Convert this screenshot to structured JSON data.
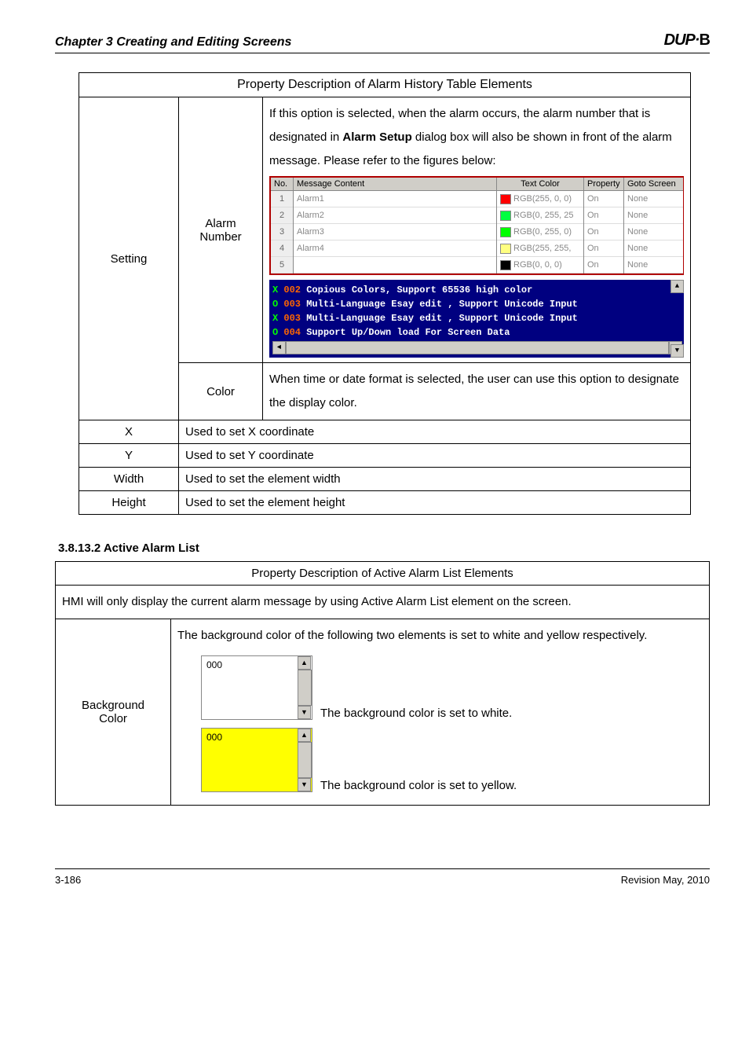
{
  "header": {
    "chapter": "Chapter 3 Creating and Editing Screens",
    "logo_prefix": "DUP",
    "logo_dot": "·",
    "logo_b": "B"
  },
  "table1": {
    "title": "Property Description of Alarm History Table Elements",
    "setting_label": "Setting",
    "alarm_number_label_l1": "Alarm",
    "alarm_number_label_l2": "Number",
    "alarm_desc": "If this option is selected, when the alarm occurs, the alarm number that is designated in <b>Alarm Setup</b> dialog box will also be shown in front of the alarm message. Please refer to the figures below:",
    "grid": {
      "headers": {
        "no": "No.",
        "msg": "Message Content",
        "tc": "Text Color",
        "prop": "Property",
        "goto": "Goto Screen"
      },
      "rows": [
        {
          "no": "1",
          "msg": "Alarm1",
          "tc": "RGB(255, 0, 0)",
          "sw": "#ff0000",
          "prop": "On",
          "goto": "None"
        },
        {
          "no": "2",
          "msg": "Alarm2",
          "tc": "RGB(0, 255, 25",
          "sw": "#00ff25",
          "prop": "On",
          "goto": "None"
        },
        {
          "no": "3",
          "msg": "Alarm3",
          "tc": "RGB(0, 255, 0)",
          "sw": "#00ff00",
          "prop": "On",
          "goto": "None"
        },
        {
          "no": "4",
          "msg": "Alarm4",
          "tc": "RGB(255, 255,",
          "sw": "#ffff80",
          "prop": "On",
          "goto": "None"
        },
        {
          "no": "5",
          "msg": "",
          "tc": "RGB(0, 0, 0)",
          "sw": "#000000",
          "prop": "On",
          "goto": "None"
        }
      ]
    },
    "blue": {
      "l1": {
        "mark": "X",
        "num": "002",
        "txt": "Copious Colors, Support 65536 high color"
      },
      "l2": {
        "mark": "O",
        "num": "003",
        "txt": "Multi-Language Esay edit , Support Unicode Input"
      },
      "l3": {
        "mark": "X",
        "num": "003",
        "txt": "Multi-Language Esay edit , Support Unicode Input"
      },
      "l4": {
        "mark": "O",
        "num": "004",
        "txt": "Support Up/Down load For Screen Data"
      }
    },
    "color_label": "Color",
    "color_desc": "When time or date format is selected, the user can use this option to designate the display color.",
    "x_label": "X",
    "x_desc": "Used to set X coordinate",
    "y_label": "Y",
    "y_desc": "Used to set Y coordinate",
    "w_label": "Width",
    "w_desc": "Used to set the element width",
    "h_label": "Height",
    "h_desc": "Used to set the element height"
  },
  "section2_heading": "3.8.13.2 Active Alarm List",
  "table2": {
    "title": "Property Description of Active Alarm List Elements",
    "intro": "HMI will only display the current alarm message by using Active Alarm List element on the screen.",
    "bg_label_l1": "Background",
    "bg_label_l2": "Color",
    "bg_desc": "The background color of the following two elements is set to white and yellow respectively.",
    "box1_val": "000",
    "box1_cap": "The background color is set to white.",
    "box2_val": "000",
    "box2_cap": "The background color is set to yellow."
  },
  "footer": {
    "page": "3-186",
    "rev": "Revision May, 2010"
  }
}
